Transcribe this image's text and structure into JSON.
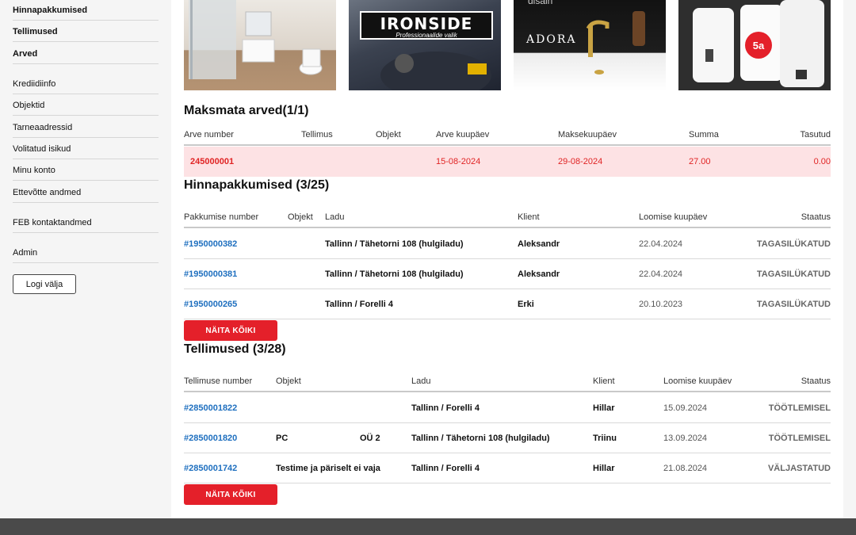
{
  "sidebar": {
    "items": [
      {
        "label": "Hinnapakkumised"
      },
      {
        "label": "Tellimused"
      },
      {
        "label": "Arved"
      },
      {
        "label": "Krediidiinfo"
      },
      {
        "label": "Objektid"
      },
      {
        "label": "Tarneaadressid"
      },
      {
        "label": "Volitatud isikud"
      },
      {
        "label": "Minu konto"
      },
      {
        "label": "Ettevõtte andmed"
      },
      {
        "label": "FEB kontaktandmed"
      },
      {
        "label": "Admin"
      }
    ],
    "logout_label": "Logi välja"
  },
  "banners": {
    "b2_brand": "IRONSIDE",
    "b2_tagline": "Professionaalide valik",
    "b3_top": "disain",
    "b3_brand": "ADORA",
    "b4_badge": "5a"
  },
  "invoices": {
    "title": "Maksmata arved(1/1)",
    "columns": [
      "Arve number",
      "Tellimus",
      "Objekt",
      "Arve kuupäev",
      "Maksekuupäev",
      "Summa",
      "Tasutud"
    ],
    "rows": [
      {
        "number": "245000001",
        "order": "",
        "object": "",
        "date": "15-08-2024",
        "due": "29-08-2024",
        "sum": "27.00",
        "paid": "0.00"
      }
    ]
  },
  "quotes": {
    "title": "Hinnapakkumised (3/25)",
    "columns": [
      "Pakkumise number",
      "Objekt",
      "Ladu",
      "Klient",
      "Loomise kuupäev",
      "Staatus"
    ],
    "rows": [
      {
        "number": "#1950000382",
        "object": "",
        "warehouse": "Tallinn / Tähetorni 108 (hulgiladu)",
        "client": "Aleksandr",
        "date": "22.04.2024",
        "status": "TAGASILÜKATUD"
      },
      {
        "number": "#1950000381",
        "object": "",
        "warehouse": "Tallinn / Tähetorni 108 (hulgiladu)",
        "client": "Aleksandr",
        "date": "22.04.2024",
        "status": "TAGASILÜKATUD"
      },
      {
        "number": "#1950000265",
        "object": "",
        "warehouse": "Tallinn / Forelli 4",
        "client": "Erki",
        "date": "20.10.2023",
        "status": "TAGASILÜKATUD"
      }
    ],
    "show_all": "NÄITA KÕIKI"
  },
  "orders": {
    "title": "Tellimused (3/28)",
    "columns": [
      "Tellimuse number",
      "Objekt",
      "Ladu",
      "Klient",
      "Loomise kuupäev",
      "Staatus"
    ],
    "rows": [
      {
        "number": "#2850001822",
        "object": "",
        "object_extra": "",
        "warehouse": "Tallinn / Forelli 4",
        "client": "Hillar",
        "date": "15.09.2024",
        "status": "TÖÖTLEMISEL"
      },
      {
        "number": "#2850001820",
        "object": "PC",
        "object_extra": "OÜ 2",
        "warehouse": "Tallinn / Tähetorni 108 (hulgiladu)",
        "client": "Triinu",
        "date": "13.09.2024",
        "status": "TÖÖTLEMISEL"
      },
      {
        "number": "#2850001742",
        "object": "Testime ja päriselt ei vaja",
        "object_extra": "",
        "warehouse": "Tallinn / Forelli 4",
        "client": "Hillar",
        "date": "21.08.2024",
        "status": "VÄLJASTATUD"
      }
    ],
    "show_all": "NÄITA KÕIKI"
  },
  "colors": {
    "accent_red": "#e4202a",
    "link_blue": "#1e6fbf",
    "alert_bg": "#fde2e4"
  }
}
